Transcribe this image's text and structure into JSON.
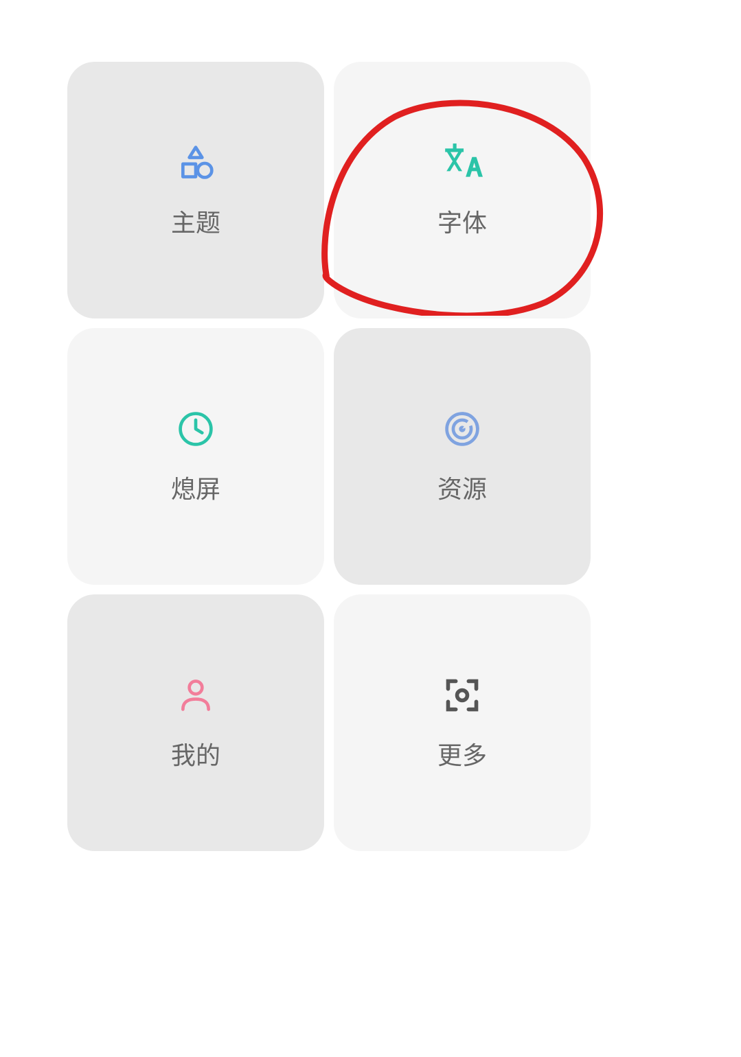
{
  "tiles": [
    {
      "label": "主题",
      "icon": "shapes-icon",
      "style": "dark",
      "color": "#5b93e6"
    },
    {
      "label": "字体",
      "icon": "translate-icon",
      "style": "lightest",
      "color": "#2bc4a8"
    },
    {
      "label": "熄屏",
      "icon": "clock-icon",
      "style": "lightest",
      "color": "#2bc4a8"
    },
    {
      "label": "资源",
      "icon": "radar-icon",
      "style": "dark",
      "color": "#7fa3e0"
    },
    {
      "label": "我的",
      "icon": "person-icon",
      "style": "dark",
      "color": "#f27d9a"
    },
    {
      "label": "更多",
      "icon": "scan-icon",
      "style": "lightest",
      "color": "#555555"
    }
  ],
  "annotation": {
    "type": "circle-highlight",
    "color": "#e02020",
    "targets_tile_index": 1
  }
}
